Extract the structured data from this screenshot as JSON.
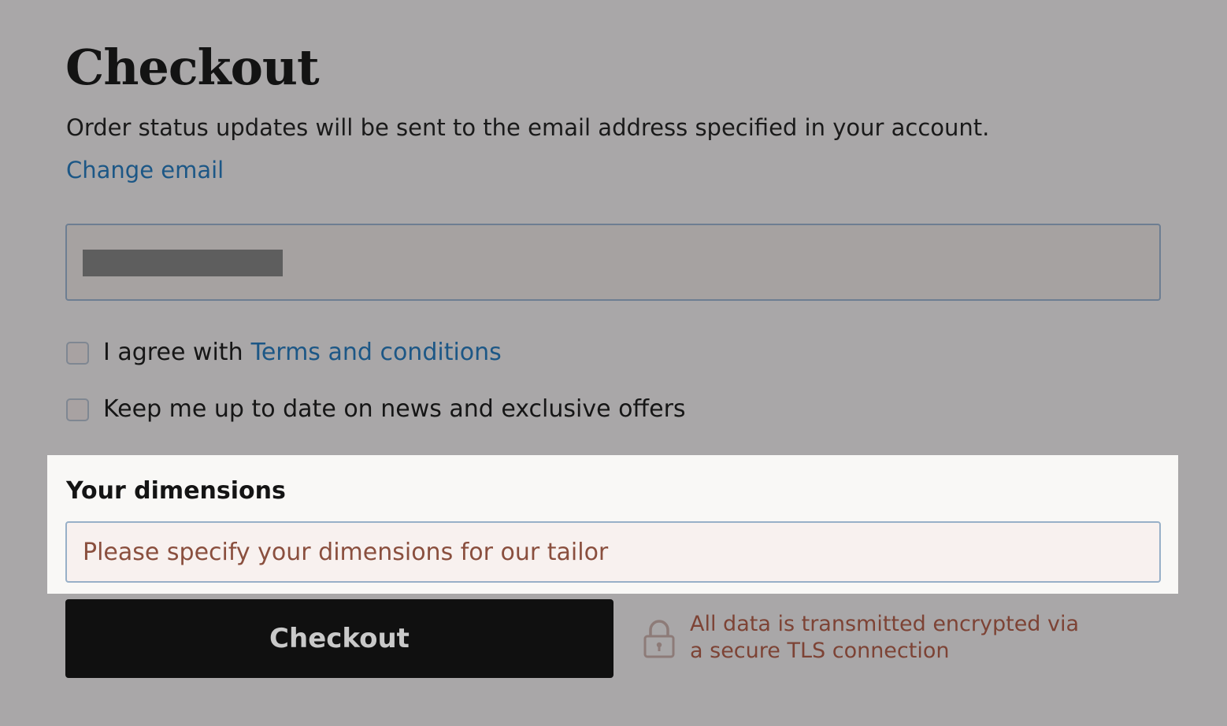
{
  "header": {
    "title": "Checkout",
    "intro": "Order status updates will be sent to the email address specified in your account.",
    "change_email_link": "Change email"
  },
  "email_field": {
    "value": ""
  },
  "consents": {
    "terms_prefix": "I agree with",
    "terms_link": "Terms and conditions",
    "newsletter_label": "Keep me up to date on news and exclusive offers"
  },
  "dimensions": {
    "label": "Your dimensions",
    "placeholder": "Please specify your dimensions for our tailor"
  },
  "checkout": {
    "button_label": "Checkout",
    "security_line_1": "All data is transmitted encrypted via",
    "security_line_2": "a secure TLS connection",
    "security_icon": "lock-icon"
  },
  "colors": {
    "background": "#a9a7a8",
    "link": "#1c5786",
    "highlight_panel": "#f9f8f6",
    "button": "#101010",
    "security_text": "#7d4335"
  }
}
